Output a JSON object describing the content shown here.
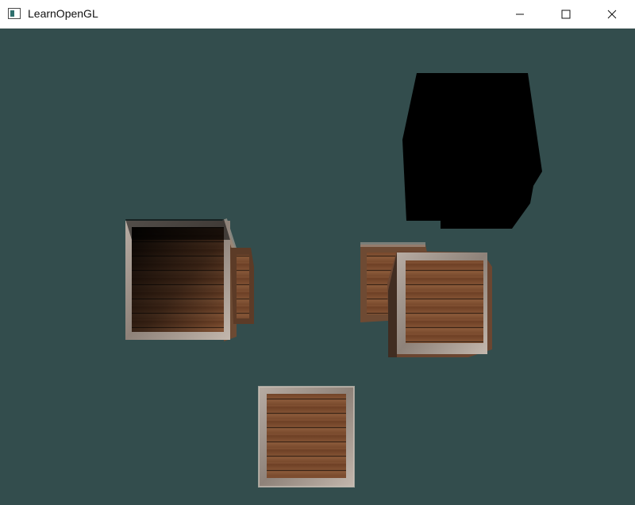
{
  "window": {
    "title": "LearnOpenGL",
    "icon": "app-window-icon",
    "controls": [
      "minimize-icon",
      "maximize-icon",
      "close-icon"
    ]
  },
  "viewport": {
    "clear_color": "#334d4d",
    "crate_wood_color": "#7a4a2e",
    "crate_metal_color": "#9a8f86",
    "shadow_color": "#000000"
  }
}
